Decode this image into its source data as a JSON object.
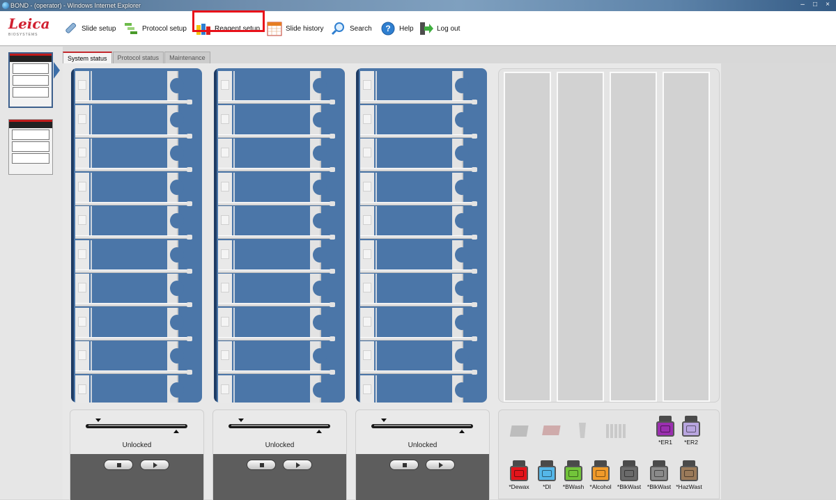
{
  "window": {
    "title": "BOND - (operator) - Windows Internet Explorer",
    "controls": {
      "minimize": "–",
      "maximize": "□",
      "close": "×"
    }
  },
  "app": {
    "logo_text": "Leica",
    "logo_sub": "BIOSYSTEMS"
  },
  "toolbar": {
    "items": [
      {
        "label": "Slide setup",
        "icon": "slide-icon"
      },
      {
        "label": "Protocol setup",
        "icon": "protocol-icon"
      },
      {
        "label": "Reagent setup",
        "icon": "reagent-icon",
        "highlighted": true
      },
      {
        "label": "Slide history",
        "icon": "calendar-icon"
      },
      {
        "label": "Search",
        "icon": "search-icon"
      },
      {
        "label": "Help",
        "icon": "help-icon"
      },
      {
        "label": "Log out",
        "icon": "logout-icon"
      }
    ],
    "highlight_color": "#e8121a"
  },
  "tabs": [
    {
      "label": "System status",
      "active": true
    },
    {
      "label": "Protocol status",
      "active": false
    },
    {
      "label": "Maintenance",
      "active": false
    }
  ],
  "trays": [
    {
      "status": "Unlocked",
      "slides": 10
    },
    {
      "status": "Unlocked",
      "slides": 10
    },
    {
      "status": "Unlocked",
      "slides": 10
    }
  ],
  "bulk_reagents": {
    "top": [
      {
        "label": "*ER1",
        "color": "#9b2fb0"
      },
      {
        "label": "*ER2",
        "color": "#b9a6e0"
      }
    ],
    "bottom": [
      {
        "label": "*Dewax",
        "color": "#e3141b"
      },
      {
        "label": "*DI",
        "color": "#55b7e9"
      },
      {
        "label": "*BWash",
        "color": "#72c43a"
      },
      {
        "label": "*Alcohol",
        "color": "#f09a2a"
      },
      {
        "label": "*BlkWast",
        "color": "#6a6a6a"
      },
      {
        "label": "*BlkWast",
        "color": "#8a8a8a"
      },
      {
        "label": "*HazWast",
        "color": "#9a7a5a"
      }
    ]
  },
  "colors": {
    "tray_blue": "#4b76a8",
    "accent_red": "#c3272b"
  }
}
